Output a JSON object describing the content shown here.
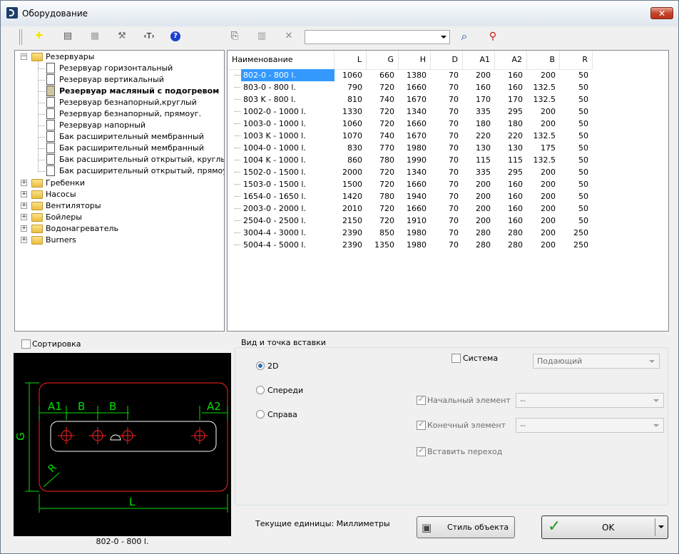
{
  "window": {
    "title": "Оборудование",
    "close_glyph": "✕"
  },
  "toolbar": {
    "buttons": [
      {
        "name": "add-icon",
        "glyph": "✚",
        "color": "#f2e600"
      },
      {
        "name": "edit-icon",
        "glyph": "▤",
        "color": "#555555"
      },
      {
        "name": "list-icon",
        "glyph": "▦",
        "color": "#9a9a9a"
      },
      {
        "name": "tools-icon",
        "glyph": "⚒",
        "color": "#6a6a6a"
      },
      {
        "name": "text-icon",
        "glyph": "‹T›",
        "color": "#000000"
      },
      {
        "name": "help-icon",
        "glyph": "?",
        "color": "#1a3fd0"
      },
      {
        "name": "copy-icon",
        "glyph": "⎘",
        "color": "#333333"
      },
      {
        "name": "table-icon",
        "glyph": "▥",
        "color": "#9a9a9a"
      },
      {
        "name": "delete-icon",
        "glyph": "✕",
        "color": "#8a8a8a"
      }
    ],
    "search_value": "",
    "search_btn_glyph": "⌕",
    "binoculars_glyph": "⚲"
  },
  "tree": {
    "root": "Резервуары",
    "children": [
      "Резервуар горизонтальный",
      "Резервуар вертикальный",
      "Резервуар масляный с подогревом",
      "Резервуар безнапорный,круглый",
      "Резервуар безнапорный, прямоуг.",
      "Резервуар напорный",
      "Бак расширительный мембранный",
      "Бак расширительный мембранный",
      "Бак расширительный открытый, круглый",
      "Бак расширительный открытый, прямоуг."
    ],
    "selected_index": 2,
    "others": [
      "Гребенки",
      "Насосы",
      "Вентиляторы",
      "Бойлеры",
      "Водонагреватель",
      "Burners"
    ]
  },
  "table": {
    "columns": [
      "Наименование",
      "L",
      "G",
      "H",
      "D",
      "A1",
      "A2",
      "B",
      "R"
    ],
    "rows": [
      [
        "802-0 - 800 l.",
        "1060",
        "660",
        "1380",
        "70",
        "200",
        "160",
        "200",
        "50"
      ],
      [
        "803-0 - 800 l.",
        "790",
        "720",
        "1660",
        "70",
        "160",
        "160",
        "132.5",
        "50"
      ],
      [
        "803 K - 800 l.",
        "810",
        "740",
        "1670",
        "70",
        "170",
        "170",
        "132.5",
        "50"
      ],
      [
        "1002-0 - 1000 l.",
        "1330",
        "720",
        "1340",
        "70",
        "335",
        "295",
        "200",
        "50"
      ],
      [
        "1003-0 - 1000 l.",
        "1060",
        "720",
        "1660",
        "70",
        "180",
        "180",
        "200",
        "50"
      ],
      [
        "1003 K - 1000 l.",
        "1070",
        "740",
        "1670",
        "70",
        "220",
        "220",
        "132.5",
        "50"
      ],
      [
        "1004-0 - 1000 l.",
        "830",
        "770",
        "1980",
        "70",
        "130",
        "130",
        "175",
        "50"
      ],
      [
        "1004 K - 1000 l.",
        "860",
        "780",
        "1990",
        "70",
        "115",
        "115",
        "132.5",
        "50"
      ],
      [
        "1502-0 - 1500 l.",
        "2000",
        "720",
        "1340",
        "70",
        "335",
        "295",
        "200",
        "50"
      ],
      [
        "1503-0 - 1500 l.",
        "1500",
        "720",
        "1660",
        "70",
        "200",
        "160",
        "200",
        "50"
      ],
      [
        "1654-0 - 1650 l.",
        "1420",
        "780",
        "1940",
        "70",
        "200",
        "160",
        "200",
        "50"
      ],
      [
        "2003-0 - 2000 l.",
        "2010",
        "720",
        "1660",
        "70",
        "200",
        "160",
        "200",
        "50"
      ],
      [
        "2504-0 - 2500 l.",
        "2150",
        "720",
        "1910",
        "70",
        "200",
        "160",
        "200",
        "50"
      ],
      [
        "3004-4 - 3000 l.",
        "2390",
        "850",
        "1980",
        "70",
        "280",
        "280",
        "200",
        "250"
      ],
      [
        "5004-4 - 5000 l.",
        "2390",
        "1350",
        "1980",
        "70",
        "280",
        "280",
        "200",
        "250"
      ]
    ],
    "selected_row": 0
  },
  "sort_label": "Сортировка",
  "preview": {
    "caption": "802-0 - 800 l.",
    "labels": {
      "a1": "A1",
      "b1": "B",
      "b2": "B",
      "a2": "A2",
      "g": "G",
      "r": "R",
      "l": "L"
    }
  },
  "view": {
    "title": "Вид и точка вставки",
    "options": [
      "2D",
      "Спереди",
      "Справа"
    ],
    "selected": 0,
    "system_label": "Система",
    "system_value": "Подающий",
    "start_label": "Начальный элемент",
    "start_value": "--",
    "end_label": "Конечный элемент",
    "end_value": "--",
    "transition_label": "Вставить переход"
  },
  "footer": {
    "units_text": "Текущие единицы: Миллиметры",
    "style_button": "Стиль объекта",
    "ok_button": "OK"
  },
  "colors": {
    "selection": "#3399ff",
    "cad_red": "#ff2020",
    "cad_green": "#00e000",
    "cad_white": "#ffffff"
  }
}
